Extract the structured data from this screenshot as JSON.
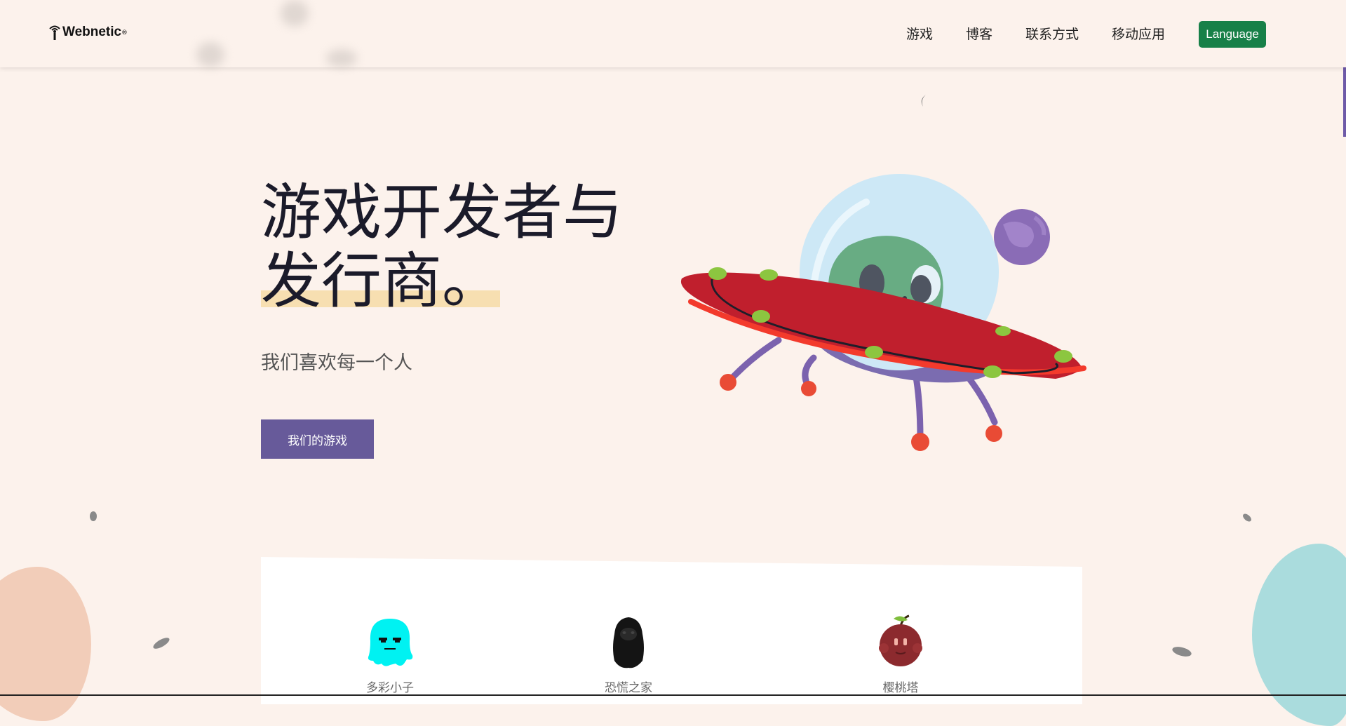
{
  "header": {
    "logo_text": "Webnetic",
    "logo_mark": "®",
    "nav": [
      {
        "label": "游戏"
      },
      {
        "label": "博客"
      },
      {
        "label": "联系方式"
      },
      {
        "label": "移动应用"
      }
    ],
    "language_button": "Language",
    "accent_color": "#178048"
  },
  "hero": {
    "title_line1": "游戏开发者与",
    "title_line2": "发行商。",
    "subtitle": "我们喜欢每一个人",
    "cta_label": "我们的游戏",
    "cta_color": "#675a9a",
    "illustration": "alien-ufo-illustration"
  },
  "games": [
    {
      "title": "多彩小子",
      "icon": "cyan-blob-character-icon"
    },
    {
      "title": "恐慌之家",
      "icon": "black-gorilla-character-icon"
    },
    {
      "title": "樱桃塔",
      "icon": "cherry-character-icon"
    }
  ]
}
